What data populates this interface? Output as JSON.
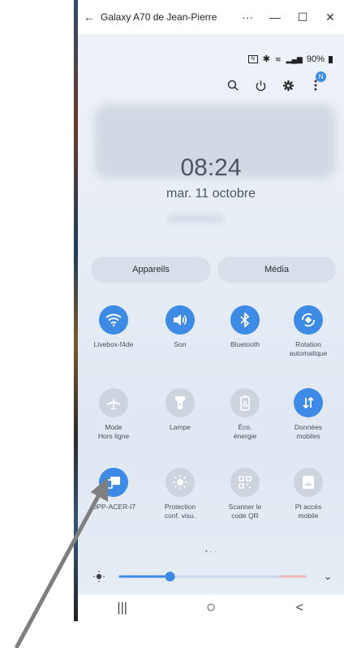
{
  "window": {
    "title": "Galaxy A70 de Jean-Pierre",
    "back_glyph": "←",
    "more_glyph": "···",
    "minimize_glyph": "—",
    "maximize_glyph": "☐",
    "close_glyph": "✕"
  },
  "status_bar": {
    "battery": "90%"
  },
  "lock": {
    "time": "08:24",
    "date": "mar. 11 octobre"
  },
  "top_icons": {
    "badge": "N"
  },
  "panel_tabs": {
    "devices": "Appareils",
    "media": "Média"
  },
  "tiles": [
    {
      "label_line1": "Livebox-f4de",
      "label_line2": ""
    },
    {
      "label_line1": "Son",
      "label_line2": ""
    },
    {
      "label_line1": "Bluetooth",
      "label_line2": ""
    },
    {
      "label_line1": "Rotation",
      "label_line2": "automatique"
    },
    {
      "label_line1": "Mode",
      "label_line2": "Hors ligne"
    },
    {
      "label_line1": "Lampe",
      "label_line2": ""
    },
    {
      "label_line1": "Éco.",
      "label_line2": "énergie"
    },
    {
      "label_line1": "Données",
      "label_line2": "mobiles"
    },
    {
      "label_line1": "OPP-ACER-I7",
      "label_line2": ""
    },
    {
      "label_line1": "Protection",
      "label_line2": "conf. visu."
    },
    {
      "label_line1": "Scanner le",
      "label_line2": "code QR"
    },
    {
      "label_line1": "Pt accès",
      "label_line2": "mobile"
    }
  ],
  "tile_icons": [
    "wifi-icon",
    "sound-icon",
    "bluetooth-icon",
    "auto-rotate-icon",
    "airplane-icon",
    "flashlight-icon",
    "power-saving-icon",
    "mobile-data-icon",
    "device-cast-icon",
    "eye-comfort-icon",
    "qr-scanner-icon",
    "hotspot-icon"
  ],
  "page_indicator": "• · ·",
  "brightness": {
    "level": 0.27,
    "expand_glyph": "⌄"
  },
  "navbar": {
    "recents": "|||",
    "home": "○",
    "back": "<"
  },
  "colors": {
    "tile_on": "#3d8be4",
    "tile_off": "#cdd4dd",
    "arrow": "#7f7f7f"
  }
}
